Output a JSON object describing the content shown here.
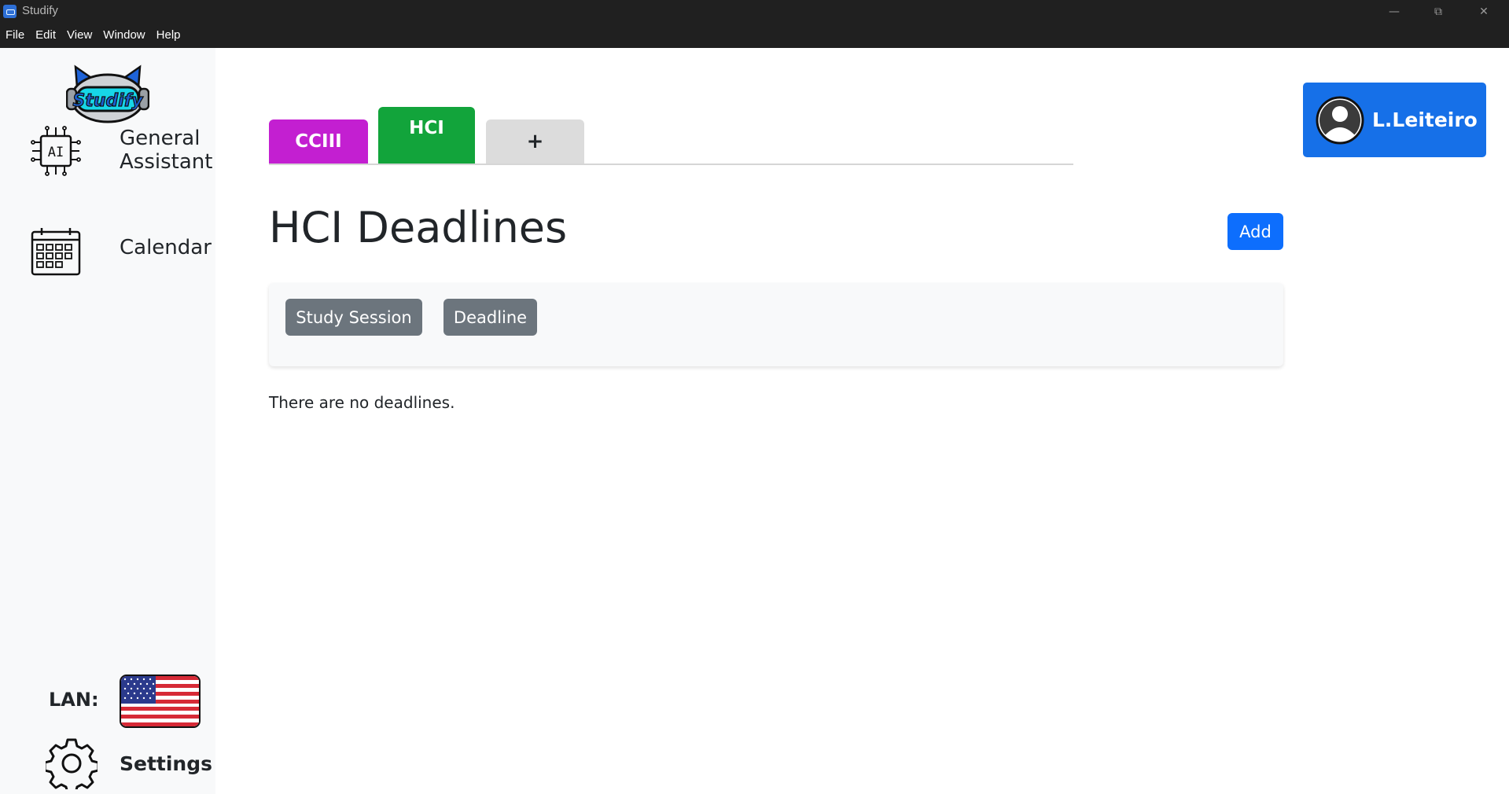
{
  "window": {
    "title": "Studify",
    "menu": [
      "File",
      "Edit",
      "View",
      "Window",
      "Help"
    ]
  },
  "sidebar": {
    "logo_text": "Studify",
    "items": [
      {
        "label": "General Assistant",
        "icon": "ai-chip-icon"
      },
      {
        "label": "Calendar",
        "icon": "calendar-icon"
      }
    ],
    "lan_label": "LAN:",
    "language_flag": "us-flag-icon",
    "settings_label": "Settings"
  },
  "tabs": [
    {
      "label": "CCIII",
      "color": "#c31fd1"
    },
    {
      "label": "HCI",
      "color": "#12a43b",
      "active": true
    },
    {
      "label": "+",
      "color": "#dcdcdc"
    }
  ],
  "main": {
    "title": "HCI Deadlines",
    "add_label": "Add",
    "filters": [
      "Study Session",
      "Deadline"
    ],
    "empty_message": "There are no deadlines."
  },
  "user": {
    "name": "L.Leiteiro",
    "icon": "user-avatar-icon"
  },
  "colors": {
    "primary": "#0d6efd",
    "secondary": "#6c757d",
    "sidebar_bg": "#f8f9fa",
    "titlebar_bg": "#202020"
  }
}
